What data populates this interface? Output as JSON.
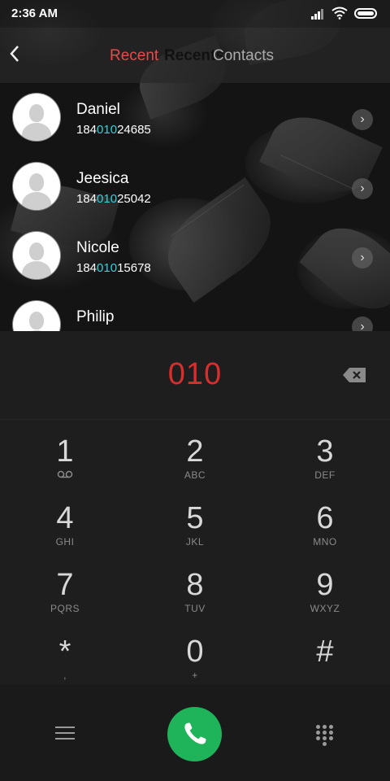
{
  "status_bar": {
    "time": "2:36 AM"
  },
  "header": {
    "back_icon": "chevron-left-icon",
    "tabs": [
      "Recent",
      "Recents",
      "Contacts"
    ]
  },
  "contacts": [
    {
      "name": "Daniel",
      "prefix": "184",
      "match": "010",
      "suffix": "24685"
    },
    {
      "name": "Jeesica",
      "prefix": "184",
      "match": "010",
      "suffix": "25042"
    },
    {
      "name": "Nicole",
      "prefix": "184",
      "match": "010",
      "suffix": "15678"
    },
    {
      "name": "Philip",
      "prefix": "",
      "match": "",
      "suffix": ""
    }
  ],
  "dialer": {
    "entered": "010",
    "keys": [
      {
        "digit": "1",
        "letters": ""
      },
      {
        "digit": "2",
        "letters": "ABC"
      },
      {
        "digit": "3",
        "letters": "DEF"
      },
      {
        "digit": "4",
        "letters": "GHI"
      },
      {
        "digit": "5",
        "letters": "JKL"
      },
      {
        "digit": "6",
        "letters": "MNO"
      },
      {
        "digit": "7",
        "letters": "PQRS"
      },
      {
        "digit": "8",
        "letters": "TUV"
      },
      {
        "digit": "9",
        "letters": "WXYZ"
      },
      {
        "digit": "*",
        "letters": ","
      },
      {
        "digit": "0",
        "letters": "+"
      },
      {
        "digit": "#",
        "letters": ""
      }
    ]
  },
  "colors": {
    "accent_red": "#d82e2e",
    "match_cyan": "#35d0d8",
    "call_green": "#1fb35a"
  }
}
